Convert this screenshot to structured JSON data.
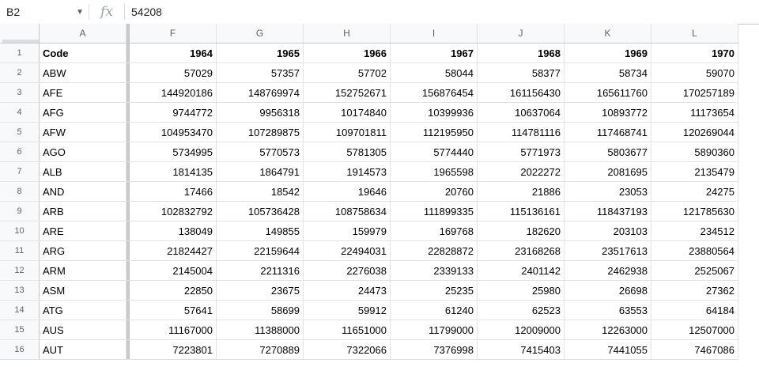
{
  "formula_bar": {
    "name_box": "B2",
    "fx": "fx",
    "value": "54208"
  },
  "column_headers": [
    "A",
    "F",
    "G",
    "H",
    "I",
    "J",
    "K",
    "L"
  ],
  "rows": [
    {
      "num": "1",
      "code": "Code",
      "values": [
        "1964",
        "1965",
        "1966",
        "1967",
        "1968",
        "1969",
        "1970"
      ]
    },
    {
      "num": "2",
      "code": "ABW",
      "values": [
        "57029",
        "57357",
        "57702",
        "58044",
        "58377",
        "58734",
        "59070"
      ]
    },
    {
      "num": "3",
      "code": "AFE",
      "values": [
        "144920186",
        "148769974",
        "152752671",
        "156876454",
        "161156430",
        "165611760",
        "170257189"
      ]
    },
    {
      "num": "4",
      "code": "AFG",
      "values": [
        "9744772",
        "9956318",
        "10174840",
        "10399936",
        "10637064",
        "10893772",
        "11173654"
      ]
    },
    {
      "num": "5",
      "code": "AFW",
      "values": [
        "104953470",
        "107289875",
        "109701811",
        "112195950",
        "114781116",
        "117468741",
        "120269044"
      ]
    },
    {
      "num": "6",
      "code": "AGO",
      "values": [
        "5734995",
        "5770573",
        "5781305",
        "5774440",
        "5771973",
        "5803677",
        "5890360"
      ]
    },
    {
      "num": "7",
      "code": "ALB",
      "values": [
        "1814135",
        "1864791",
        "1914573",
        "1965598",
        "2022272",
        "2081695",
        "2135479"
      ]
    },
    {
      "num": "8",
      "code": "AND",
      "values": [
        "17466",
        "18542",
        "19646",
        "20760",
        "21886",
        "23053",
        "24275"
      ]
    },
    {
      "num": "9",
      "code": "ARB",
      "values": [
        "102832792",
        "105736428",
        "108758634",
        "111899335",
        "115136161",
        "118437193",
        "121785630"
      ]
    },
    {
      "num": "10",
      "code": "ARE",
      "values": [
        "138049",
        "149855",
        "159979",
        "169768",
        "182620",
        "203103",
        "234512"
      ]
    },
    {
      "num": "11",
      "code": "ARG",
      "values": [
        "21824427",
        "22159644",
        "22494031",
        "22828872",
        "23168268",
        "23517613",
        "23880564"
      ]
    },
    {
      "num": "12",
      "code": "ARM",
      "values": [
        "2145004",
        "2211316",
        "2276038",
        "2339133",
        "2401142",
        "2462938",
        "2525067"
      ]
    },
    {
      "num": "13",
      "code": "ASM",
      "values": [
        "22850",
        "23675",
        "24473",
        "25235",
        "25980",
        "26698",
        "27362"
      ]
    },
    {
      "num": "14",
      "code": "ATG",
      "values": [
        "57641",
        "58699",
        "59912",
        "61240",
        "62523",
        "63553",
        "64184"
      ]
    },
    {
      "num": "15",
      "code": "AUS",
      "values": [
        "11167000",
        "11388000",
        "11651000",
        "11799000",
        "12009000",
        "12263000",
        "12507000"
      ]
    },
    {
      "num": "16",
      "code": "AUT",
      "values": [
        "7223801",
        "7270889",
        "7322066",
        "7376998",
        "7415403",
        "7441055",
        "7467086"
      ]
    }
  ]
}
